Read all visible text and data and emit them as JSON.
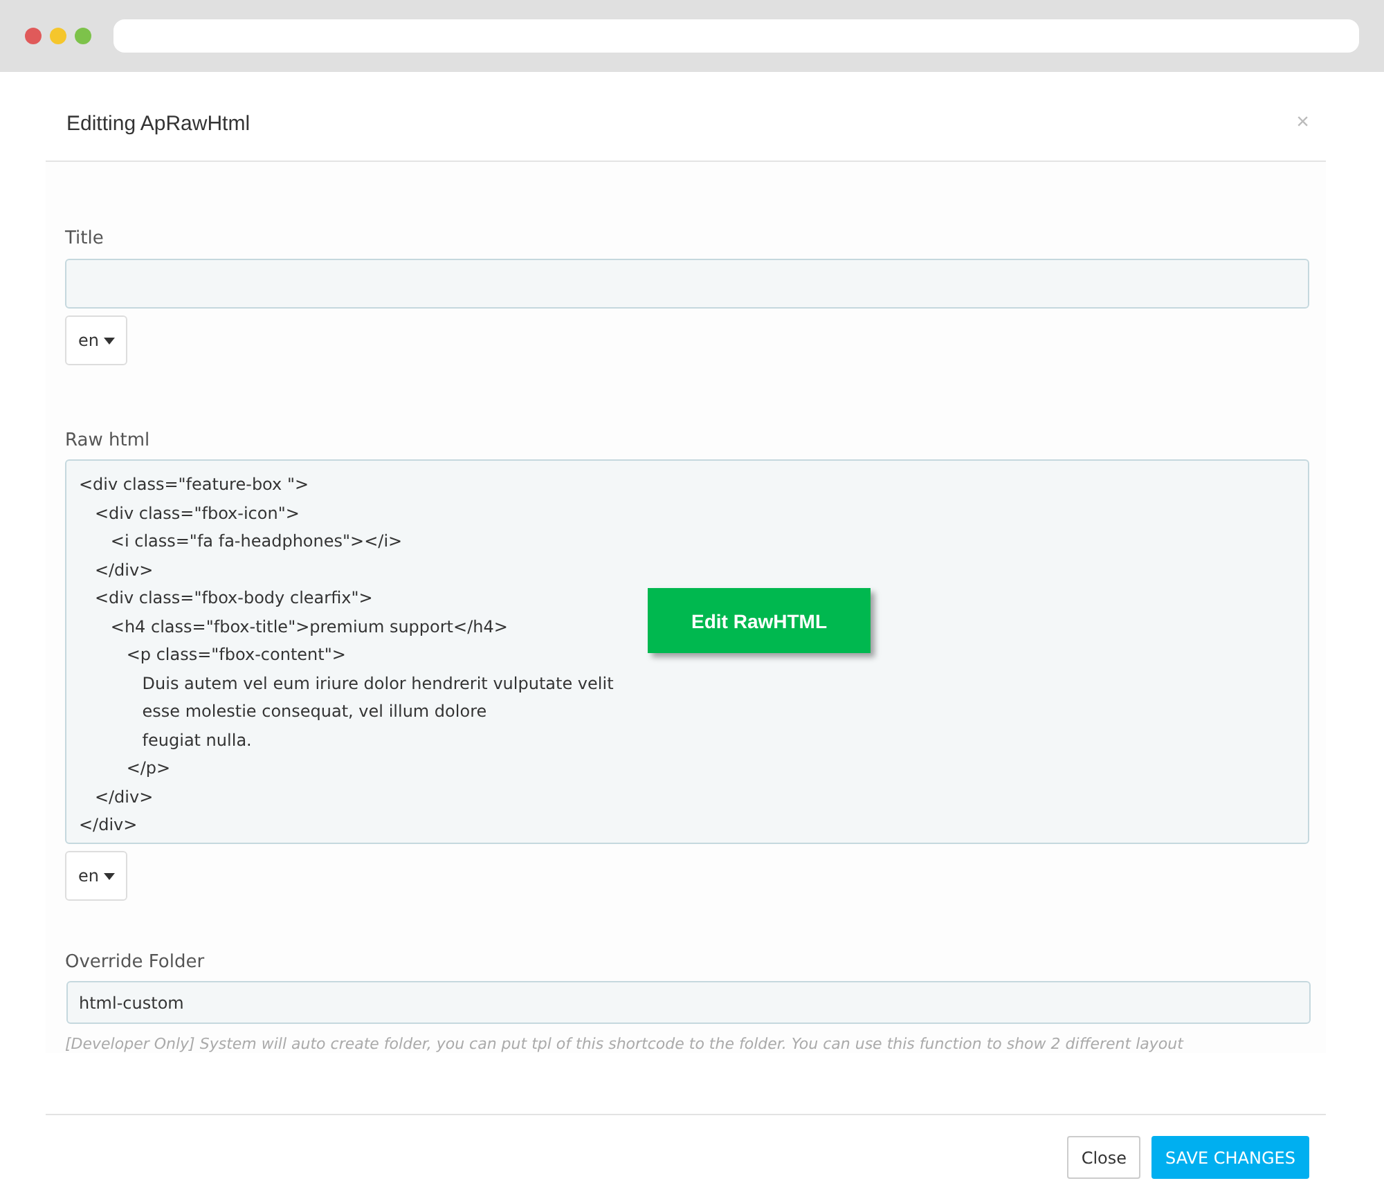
{
  "window": {
    "traffic_lights": [
      {
        "color": "#e05a5a"
      },
      {
        "color": "#f5c62c"
      },
      {
        "color": "#7dc24a"
      }
    ]
  },
  "modal": {
    "title": "Editting ApRawHtml",
    "close": "×"
  },
  "title_field": {
    "label": "Title",
    "language": "en"
  },
  "raw_html": {
    "label": "Raw html",
    "value": "<div class=\"feature-box \">\n   <div class=\"fbox-icon\">\n      <i class=\"fa fa-headphones\"></i>\n   </div>\n   <div class=\"fbox-body clearfix\">\n      <h4 class=\"fbox-title\">premium support</h4>\n         <p class=\"fbox-content\">\n            Duis autem vel eum iriure dolor hendrerit vulputate velit\n            esse molestie consequat, vel illum dolore\n            feugiat nulla.\n         </p>\n   </div>\n</div>",
    "language": "en",
    "overlay_button": "Edit RawHTML"
  },
  "override_folder": {
    "label": "Override Folder",
    "value": "html-custom",
    "help": "[Developer Only] System will auto create folder, you can put tpl of this shortcode to the folder. You can use this function to show 2 different layout"
  },
  "buttons": [
    {
      "label": "Close",
      "kind": "default"
    },
    {
      "label": "SAVE CHANGES",
      "kind": "primary"
    }
  ]
}
